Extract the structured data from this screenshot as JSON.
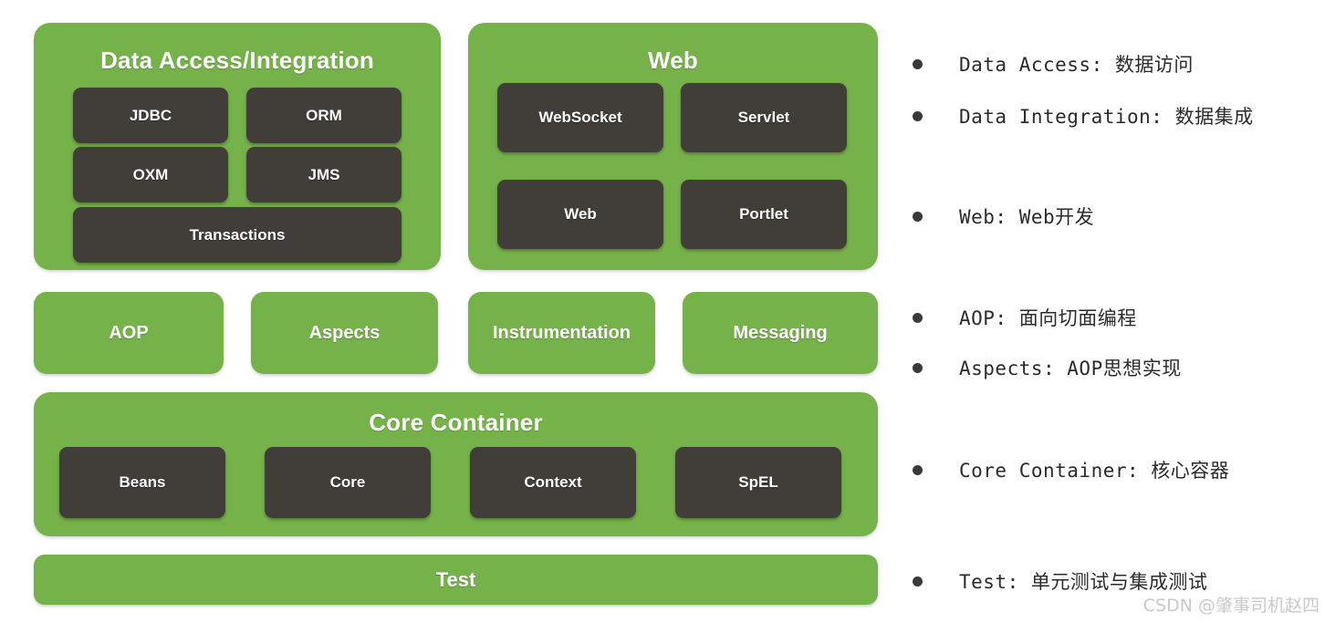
{
  "diagram": {
    "panels": [
      {
        "id": "data-access-integration",
        "title": "Data Access/Integration",
        "chips": [
          "JDBC",
          "ORM",
          "OXM",
          "JMS",
          "Transactions"
        ]
      },
      {
        "id": "web",
        "title": "Web",
        "chips": [
          "WebSocket",
          "Servlet",
          "Web",
          "Portlet"
        ]
      },
      {
        "id": "core-container",
        "title": "Core Container",
        "chips": [
          "Beans",
          "Core",
          "Context",
          "SpEL"
        ]
      }
    ],
    "solo_boxes": [
      "AOP",
      "Aspects",
      "Instrumentation",
      "Messaging"
    ],
    "test_bar": "Test"
  },
  "legend": {
    "items": [
      {
        "text": "Data Access: 数据访问"
      },
      {
        "text": "Data Integration: 数据集成"
      },
      {
        "text": "Web: Web开发"
      },
      {
        "text": "AOP: 面向切面编程"
      },
      {
        "text": "Aspects: AOP思想实现"
      },
      {
        "text": "Core Container: 核心容器"
      },
      {
        "text": "Test: 单元测试与集成测试"
      }
    ]
  },
  "watermark": "CSDN @肇事司机赵四",
  "colors": {
    "green": "#76b24a",
    "dark": "#413e3a",
    "background": "#ffffff",
    "legend_text": "#2b2b2b",
    "watermark": "#c9c9c9"
  }
}
